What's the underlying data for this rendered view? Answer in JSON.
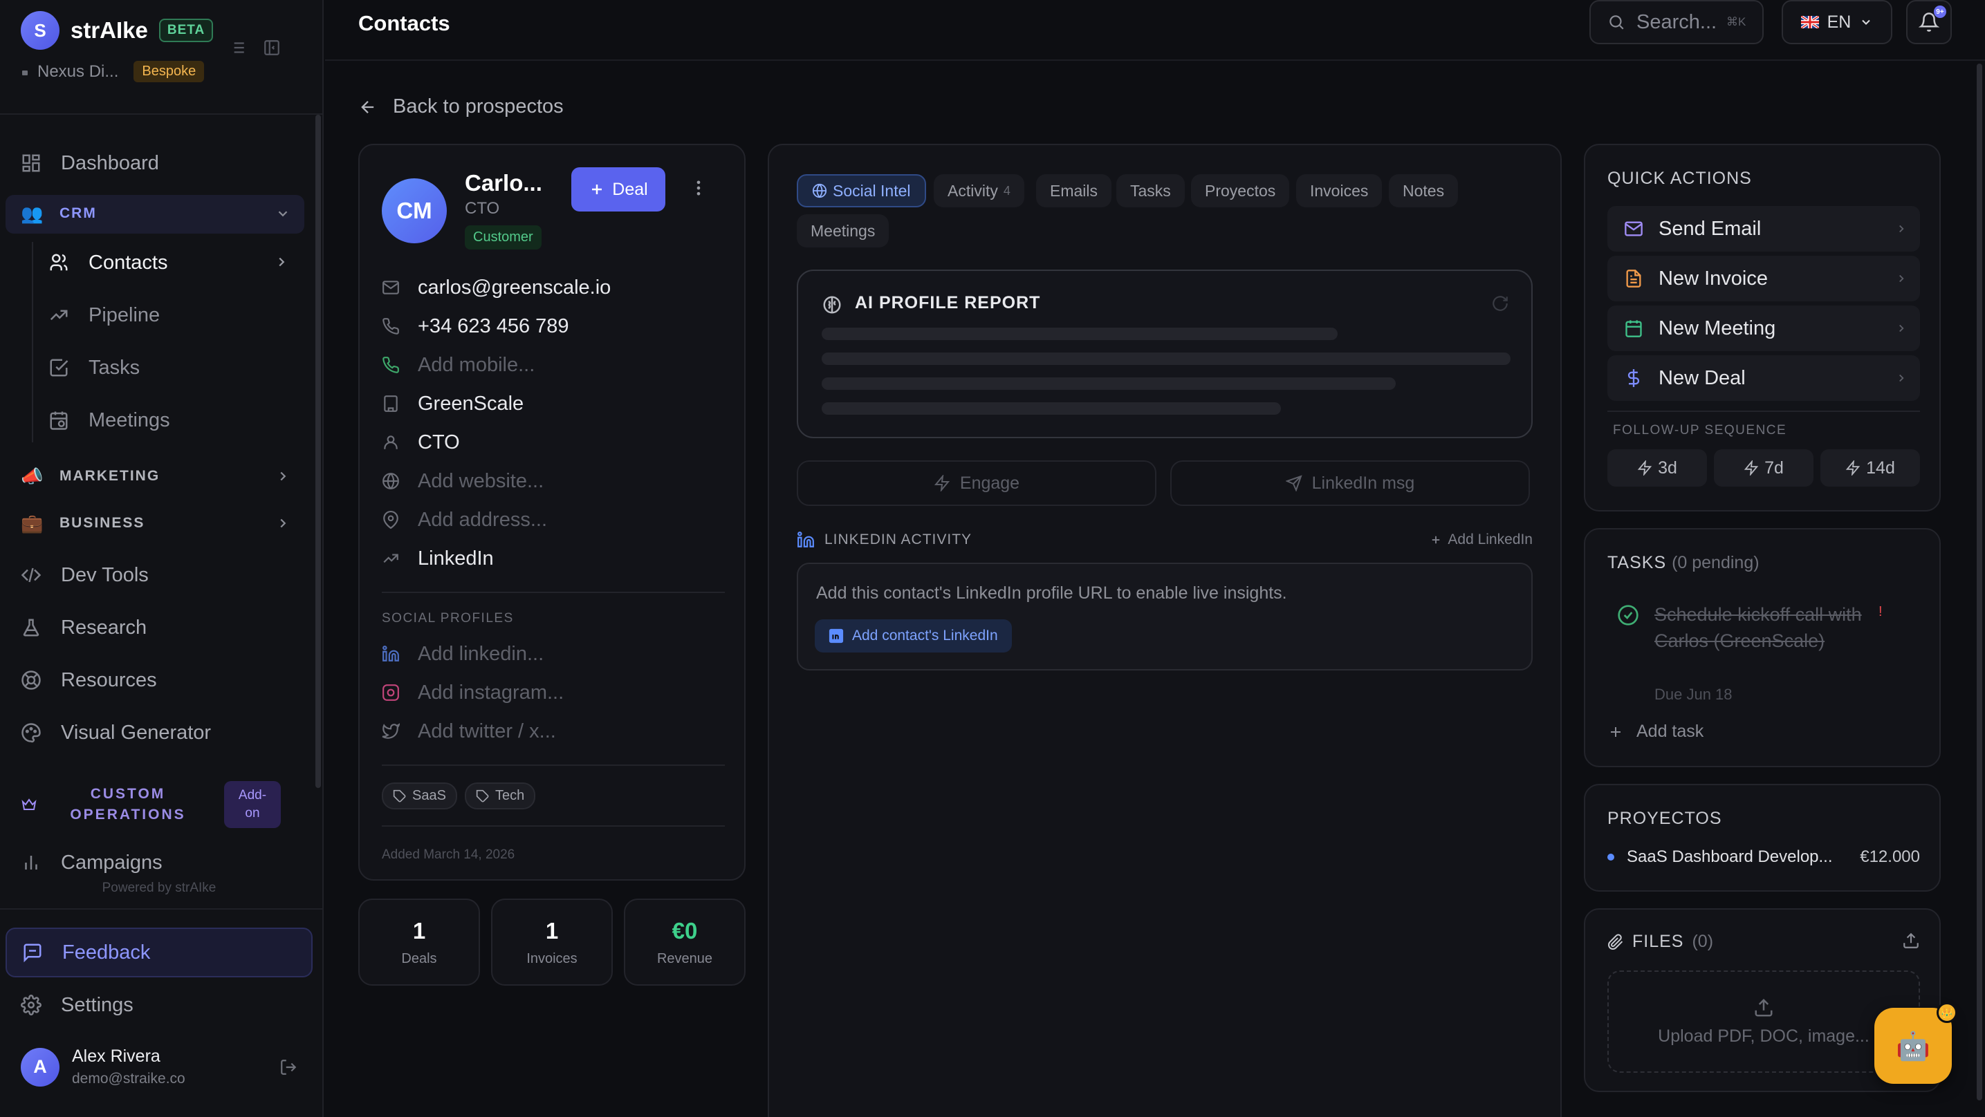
{
  "brand": {
    "logo_letter": "S",
    "name": "strAIke",
    "badge": "BETA",
    "org": "Nexus Di...",
    "plan": "Bespoke"
  },
  "sidebar": {
    "dashboard": "Dashboard",
    "crm": {
      "label": "CRM",
      "emoji": "👥"
    },
    "crm_items": {
      "contacts": "Contacts",
      "pipeline": "Pipeline",
      "tasks": "Tasks",
      "meetings": "Meetings"
    },
    "marketing": {
      "label": "MARKETING",
      "emoji": "📣"
    },
    "business": {
      "label": "BUSINESS",
      "emoji": "💼"
    },
    "dev_tools": "Dev Tools",
    "research": "Research",
    "resources": "Resources",
    "visual_generator": "Visual Generator",
    "custom_ops": {
      "line1": "CUSTOM",
      "line2": "OPERATIONS",
      "badge_line1": "Add-",
      "badge_line2": "on"
    },
    "campaigns": "Campaigns",
    "powered_by": "Powered by strAIke",
    "feedback": "Feedback",
    "settings": "Settings"
  },
  "user": {
    "initial": "A",
    "name": "Alex Rivera",
    "email": "demo@straike.co"
  },
  "header": {
    "title": "Contacts",
    "search_placeholder": "Search...",
    "search_shortcut": "⌘K",
    "language": "EN",
    "notification_badge": "9+"
  },
  "back_link": "Back to prospectos",
  "contact": {
    "initials": "CM",
    "name": "Carlo...",
    "role": "CTO",
    "status": "Customer",
    "deal_button": "Deal",
    "email": "carlos@greenscale.io",
    "phone": "+34 623 456 789",
    "mobile_placeholder": "Add mobile...",
    "company": "GreenScale",
    "title": "CTO",
    "website_placeholder": "Add website...",
    "address_placeholder": "Add address...",
    "linkedin": "LinkedIn",
    "social_label": "SOCIAL PROFILES",
    "linkedin_placeholder": "Add linkedin...",
    "instagram_placeholder": "Add instagram...",
    "twitter_placeholder": "Add twitter / x...",
    "tags": [
      "SaaS",
      "Tech"
    ],
    "added": "Added March 14, 2026"
  },
  "stats": [
    {
      "value": "1",
      "label": "Deals"
    },
    {
      "value": "1",
      "label": "Invoices"
    },
    {
      "value": "€0",
      "label": "Revenue"
    }
  ],
  "tabs": {
    "social_intel": "Social Intel",
    "activity": "Activity",
    "activity_count": "4",
    "emails": "Emails",
    "tasks": "Tasks",
    "proyectos": "Proyectos",
    "invoices": "Invoices",
    "notes": "Notes",
    "meetings": "Meetings"
  },
  "ai_report": {
    "title": "AI PROFILE REPORT"
  },
  "actions": {
    "engage": "Engage",
    "linkedin_msg": "LinkedIn msg"
  },
  "linkedin_activity": {
    "title": "LINKEDIN ACTIVITY",
    "add": "Add LinkedIn",
    "message": "Add this contact's LinkedIn profile URL to enable live insights.",
    "button": "Add contact's LinkedIn"
  },
  "quick_actions": {
    "title": "QUICK ACTIONS",
    "send_email": "Send Email",
    "new_invoice": "New Invoice",
    "new_meeting": "New Meeting",
    "new_deal": "New Deal",
    "followup_label": "FOLLOW-UP SEQUENCE",
    "fu_3d": "3d",
    "fu_7d": "7d",
    "fu_14d": "14d",
    "colors": {
      "email": "#a08cf5",
      "invoice": "#f19a4a",
      "meeting": "#3fc28a",
      "deal": "#7d8cff"
    }
  },
  "tasks_panel": {
    "title": "TASKS",
    "pending": "(0 pending)",
    "task": "Schedule kickoff call with Carlos (GreenScale)",
    "due": "Due Jun 18",
    "priority": "!",
    "add": "Add task"
  },
  "proyectos_panel": {
    "title": "PROYECTOS",
    "name": "SaaS Dashboard Develop...",
    "amount": "€12.000"
  },
  "files_panel": {
    "title": "FILES",
    "count": "(0)",
    "upload": "Upload PDF, DOC, image..."
  },
  "fab": {
    "emoji": "🤖",
    "badge": "👑"
  }
}
